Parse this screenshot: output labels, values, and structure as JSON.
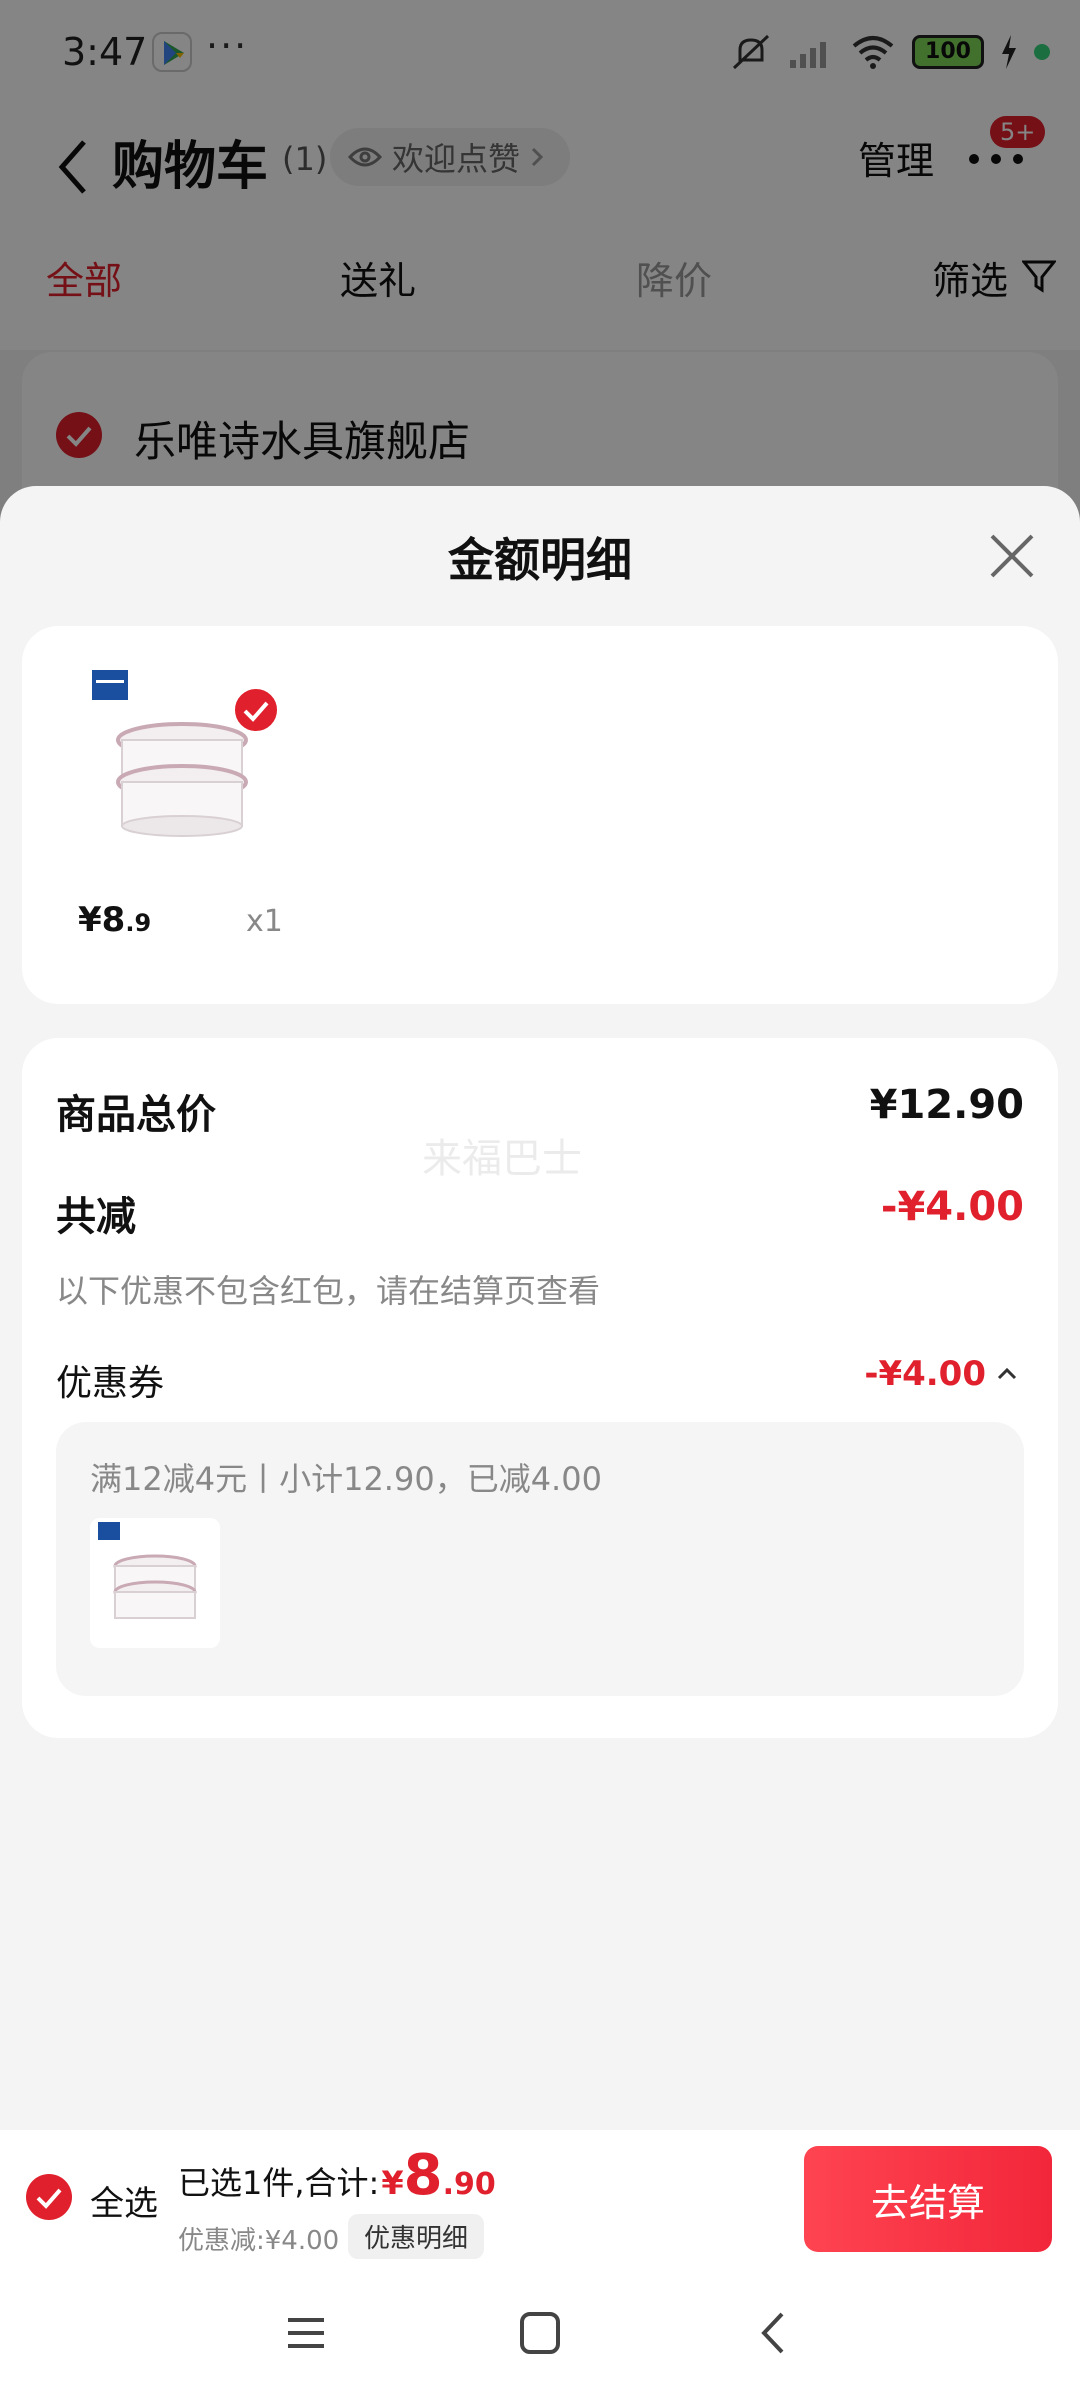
{
  "status_bar": {
    "time": "3:47",
    "dots": "···",
    "battery": "100"
  },
  "header": {
    "title": "购物车",
    "count": "(1)",
    "like_text": "欢迎点赞",
    "manage": "管理",
    "badge": "5+"
  },
  "tabs": [
    {
      "label": "全部"
    },
    {
      "label": "送礼"
    },
    {
      "label": "降价"
    },
    {
      "label": "筛选"
    }
  ],
  "store": {
    "name": "乐唯诗水具旗舰店"
  },
  "sheet": {
    "title": "金额明细",
    "item": {
      "price_symbol": "¥",
      "price_int": "8",
      "price_dec": ".9",
      "qty": "x1"
    },
    "total_label": "商品总价",
    "total_value": "¥12.90",
    "watermark": "来福巴士",
    "reduce_label": "共减",
    "reduce_value": "-¥4.00",
    "note": "以下优惠不包含红包，请在结算页查看",
    "coupon_label": "优惠券",
    "coupon_value": "-¥4.00",
    "coupon_desc": "满12减4元丨小计12.90，已减4.00"
  },
  "bottom": {
    "select_all": "全选",
    "selected_text": "已选1件,合计:",
    "sum_symbol": "¥",
    "sum_int": "8",
    "sum_dec": ".90",
    "discount": "优惠减:¥4.00",
    "detail_pill": "优惠明细",
    "checkout": "去结算"
  },
  "colors": {
    "accent": "#e0202c",
    "overlay": "rgba(0,0,0,0.48)"
  },
  "icons": [
    "back-icon",
    "eye-icon",
    "chevron-right-icon",
    "more-icon",
    "filter-icon",
    "check-icon",
    "close-icon",
    "chevron-up-icon",
    "menu-icon",
    "home-icon",
    "nav-back-icon"
  ]
}
